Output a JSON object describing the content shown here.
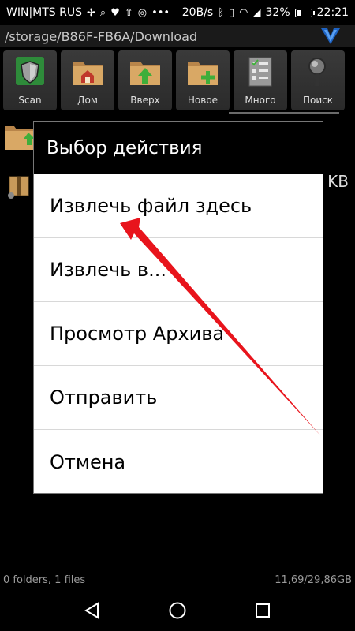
{
  "status_bar": {
    "carrier": "WIN|MTS RUS",
    "speed": "20B/s",
    "battery": "32%",
    "battery_level": 0.32,
    "time": "22:21"
  },
  "path_bar": {
    "path": "/storage/B86F-FB6A/Download"
  },
  "toolbar": {
    "buttons": [
      {
        "label": "Scan",
        "icon": "shield-icon"
      },
      {
        "label": "Дом",
        "icon": "home-folder-icon"
      },
      {
        "label": "Вверх",
        "icon": "up-folder-icon"
      },
      {
        "label": "Новое",
        "icon": "new-folder-icon"
      },
      {
        "label": "Много",
        "icon": "checklist-icon"
      },
      {
        "label": "Поиск",
        "icon": "search-icon"
      }
    ]
  },
  "file_list": {
    "file_size_partial": "l KB"
  },
  "dialog": {
    "title": "Выбор действия",
    "items": [
      {
        "label": "Извлечь файл здесь"
      },
      {
        "label": "Извлечь в..."
      },
      {
        "label": "Просмотр Архива"
      },
      {
        "label": "Отправить"
      },
      {
        "label": "Отмена"
      }
    ]
  },
  "footer": {
    "left": "0 folders, 1 files",
    "right": "11,69/29,86GB"
  },
  "annotation": {
    "arrow_color": "#e8141c"
  }
}
